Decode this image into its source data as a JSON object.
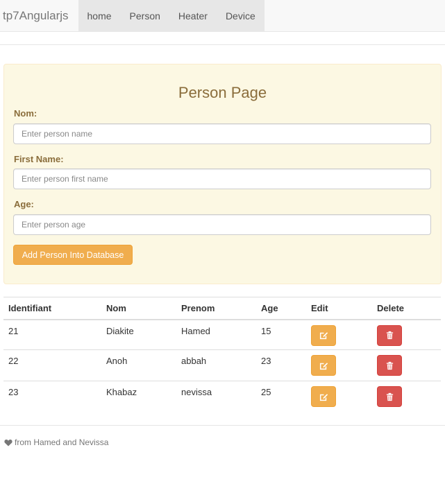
{
  "navbar": {
    "brand": "tp7Angularjs",
    "links": [
      "home",
      "Person",
      "Heater",
      "Device"
    ]
  },
  "form": {
    "title": "Person Page",
    "nom_label": "Nom:",
    "nom_placeholder": "Enter person name",
    "first_name_label": "First Name:",
    "first_name_placeholder": "Enter person first name",
    "age_label": "Age:",
    "age_placeholder": "Enter person age",
    "submit_label": "Add Person Into Database"
  },
  "table": {
    "headers": [
      "Identifiant",
      "Nom",
      "Prenom",
      "Age",
      "Edit",
      "Delete"
    ],
    "rows": [
      {
        "id": "21",
        "nom": "Diakite",
        "prenom": "Hamed",
        "age": "15"
      },
      {
        "id": "22",
        "nom": "Anoh",
        "prenom": "abbah",
        "age": "23"
      },
      {
        "id": "23",
        "nom": "Khabaz",
        "prenom": "nevissa",
        "age": "25"
      }
    ]
  },
  "footer": {
    "icon": "heart-icon",
    "text": "from Hamed and Nevissa"
  },
  "colors": {
    "warning": "#f0ad4e",
    "danger": "#d9534f",
    "panel_bg": "#fcf8e3",
    "panel_text": "#8a6d3b"
  }
}
